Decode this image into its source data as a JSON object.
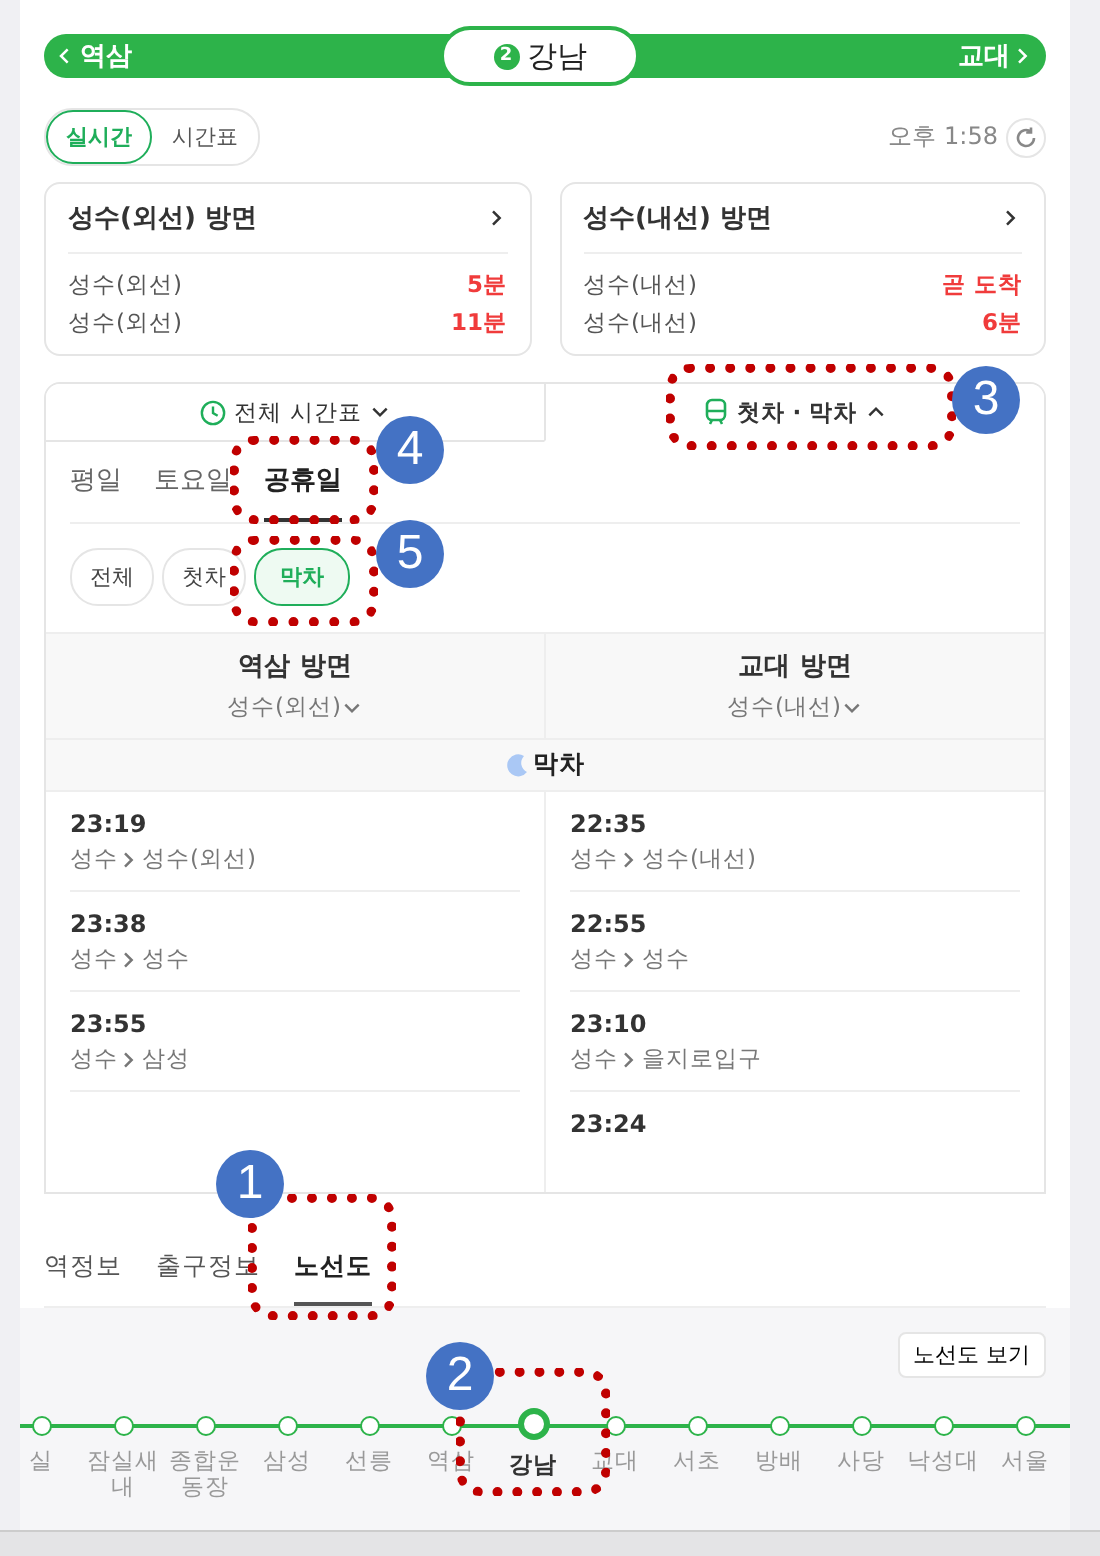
{
  "header": {
    "prev": "역삼",
    "line_badge": "2",
    "station": "강남",
    "next": "교대"
  },
  "mode_tabs": [
    {
      "label": "실시간",
      "selected": true
    },
    {
      "label": "시간표",
      "selected": false
    }
  ],
  "updated_time": "오후 1:58",
  "arrivals": [
    {
      "direction": "성수(외선) 방면",
      "trains": [
        {
          "destination": "성수(외선)",
          "eta": "5분"
        },
        {
          "destination": "성수(외선)",
          "eta": "11분"
        }
      ]
    },
    {
      "direction": "성수(내선) 방면",
      "trains": [
        {
          "destination": "성수(내선)",
          "eta": "곧 도착"
        },
        {
          "destination": "성수(내선)",
          "eta": "6분"
        }
      ]
    }
  ],
  "timetable": {
    "view_tabs": [
      {
        "label": "전체 시간표",
        "kind": "clock",
        "selected": false,
        "expanded": false
      },
      {
        "label": "첫차 · 막차",
        "kind": "train",
        "selected": true,
        "expanded": true
      }
    ],
    "day_tabs": [
      {
        "label": "평일",
        "selected": false
      },
      {
        "label": "토요일",
        "selected": false
      },
      {
        "label": "공휴일",
        "selected": true
      }
    ],
    "filter_chips": [
      {
        "label": "전체",
        "selected": false
      },
      {
        "label": "첫차",
        "selected": false
      },
      {
        "label": "막차",
        "selected": true
      }
    ],
    "directions": [
      {
        "name": "역삼 방면",
        "line": "성수(외선)"
      },
      {
        "name": "교대 방면",
        "line": "성수(내선)"
      }
    ],
    "section_title": "막차",
    "columns": [
      [
        {
          "time": "23:19",
          "from": "성수",
          "to": "성수(외선)"
        },
        {
          "time": "23:38",
          "from": "성수",
          "to": "성수"
        },
        {
          "time": "23:55",
          "from": "성수",
          "to": "삼성"
        }
      ],
      [
        {
          "time": "22:35",
          "from": "성수",
          "to": "성수(내선)"
        },
        {
          "time": "22:55",
          "from": "성수",
          "to": "성수"
        },
        {
          "time": "23:10",
          "from": "성수",
          "to": "을지로입구"
        },
        {
          "time": "23:24"
        }
      ]
    ]
  },
  "bottom_tabs": [
    {
      "label": "역정보",
      "selected": false
    },
    {
      "label": "출구정보",
      "selected": false
    },
    {
      "label": "노선도",
      "selected": true
    }
  ],
  "route_map": {
    "button": "노선도 보기",
    "stations": [
      {
        "name": "실",
        "selected": false
      },
      {
        "name": "잠실새내",
        "selected": false
      },
      {
        "name": "종합운동장",
        "selected": false
      },
      {
        "name": "삼성",
        "selected": false
      },
      {
        "name": "선릉",
        "selected": false
      },
      {
        "name": "역삼",
        "selected": false
      },
      {
        "name": "강남",
        "selected": true
      },
      {
        "name": "교대",
        "selected": false
      },
      {
        "name": "서초",
        "selected": false
      },
      {
        "name": "방배",
        "selected": false
      },
      {
        "name": "사당",
        "selected": false
      },
      {
        "name": "낙성대",
        "selected": false
      },
      {
        "name": "서울",
        "selected": false
      }
    ]
  },
  "annotations": [
    {
      "number": "1"
    },
    {
      "number": "2"
    },
    {
      "number": "3"
    },
    {
      "number": "4"
    },
    {
      "number": "5"
    }
  ]
}
